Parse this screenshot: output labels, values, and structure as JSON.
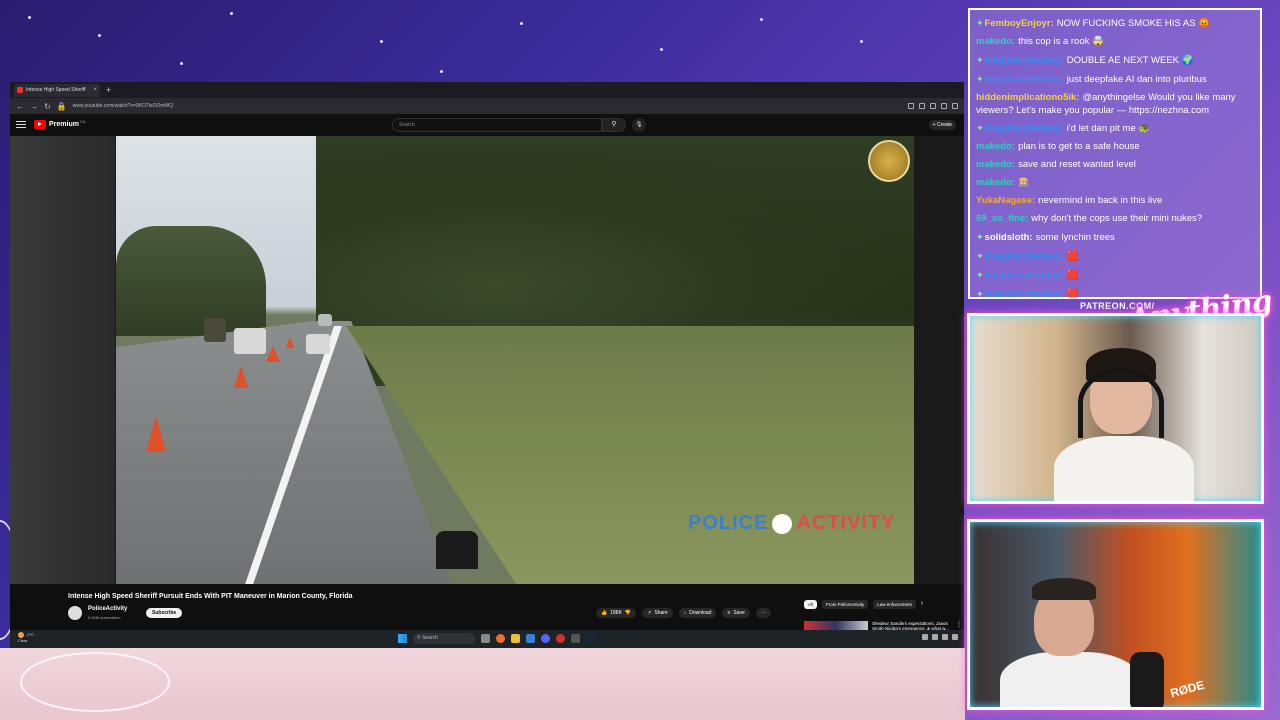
{
  "browser": {
    "tab_title": "Intense High Speed Sheriff",
    "url": "www.youtube.com/watch?v=9KO7leOOmWQ"
  },
  "youtube": {
    "logo_text": "Premium",
    "logo_region": "CA",
    "search_placeholder": "Search",
    "create_label": "Create",
    "video": {
      "watermark_left": "POLICE",
      "watermark_right": "ACTIVITY",
      "title": "Intense High Speed Sheriff Pursuit Ends With PIT Maneuver in Marion County, Florida",
      "channel_name": "PoliceActivity",
      "channel_subs": "6.62M subscribers",
      "subscribe_label": "Subscribe",
      "likes": "188K",
      "share_label": "Share",
      "download_label": "Download",
      "save_label": "Save"
    },
    "chips": [
      "All",
      "From PoliceActivity",
      "Law enforcement"
    ],
    "recommended_title": "Shedeur Sanders expectations, Jaxon Smith-Njigba's emergence, & what w..."
  },
  "taskbar": {
    "weather_temp": "-2°C",
    "weather_desc": "Clear",
    "search_label": "Search"
  },
  "chat": [
    {
      "user": "FemboyEnjoyr:",
      "color": "#f5d33a",
      "badge": true,
      "text": "NOW FUCKING SMOKE HIS AS 😡"
    },
    {
      "user": "makedo:",
      "color": "#2fd0c0",
      "badge": false,
      "text": "this cop is a rook 🤯"
    },
    {
      "user": "imaginaryfanboy:",
      "color": "#3a8cf0",
      "badge": true,
      "text": "DOUBLE AE NEXT WEEK 🌍"
    },
    {
      "user": "imaginaryfanboy:",
      "color": "#3a8cf0",
      "badge": true,
      "text": "just deepfake AI dan into pluribus"
    },
    {
      "user": "hiddenimplicationo5ik:",
      "color": "#f5d33a",
      "badge": false,
      "text": "@anythingelse Would you like many viewers? Let's make you popular — https://nezhna.com",
      "tall": true
    },
    {
      "user": "imaginaryfanboy:",
      "color": "#3a8cf0",
      "badge": true,
      "text": "i'd let dan pit me 🐢"
    },
    {
      "user": "makedo:",
      "color": "#2fd0c0",
      "badge": false,
      "text": "plan is to get to a safe house"
    },
    {
      "user": "makedo:",
      "color": "#2fd0c0",
      "badge": false,
      "text": "save and reset wanted level"
    },
    {
      "user": "makedo:",
      "color": "#2fd0c0",
      "badge": false,
      "text": "🎰"
    },
    {
      "user": "YukaNagase:",
      "color": "#f5a83a",
      "badge": false,
      "text": "nevermind im back in this live"
    },
    {
      "user": "69_so_fine:",
      "color": "#2fd0c0",
      "badge": false,
      "text": "why don't the cops use their mini nukes?"
    },
    {
      "user": "solidsloth:",
      "color": "#ffffff",
      "badge": true,
      "text": "some lynchin trees"
    },
    {
      "user": "imaginaryfanboy:",
      "color": "#3a8cf0",
      "badge": true,
      "text": "🟥"
    },
    {
      "user": "imaginaryfanboy:",
      "color": "#3a8cf0",
      "badge": true,
      "text": "🟥"
    },
    {
      "user": "imaginaryfanboy:",
      "color": "#3a8cf0",
      "badge": true,
      "text": "🟥"
    }
  ],
  "overlay": {
    "patreon": "PATREON.COM/",
    "brand": "Anything Else",
    "mic_brand": "RØDE"
  }
}
